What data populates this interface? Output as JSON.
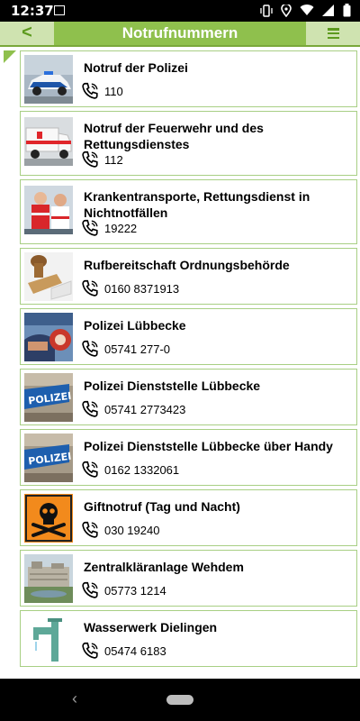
{
  "status": {
    "time": "12:37"
  },
  "appbar": {
    "back_label": "<",
    "title": "Notrufnummern"
  },
  "entries": [
    {
      "name": "Notruf der Polizei",
      "number": "110",
      "icon": "police-car-photo"
    },
    {
      "name": "Notruf der Feuerwehr und des Rettungsdienstes",
      "number": "112",
      "icon": "ambulance-photo"
    },
    {
      "name": "Krankentransporte, Rettungsdienst in Nichtnotfällen",
      "number": "19222",
      "icon": "paramedics-photo"
    },
    {
      "name": "Rufbereitschaft Ordnungsbehörde",
      "number": "0160 8371913",
      "icon": "stamp-photo"
    },
    {
      "name": "Polizei Lübbecke",
      "number": "05741 277-0",
      "icon": "police-officer-photo"
    },
    {
      "name": "Polizei Dienststelle Lübbecke",
      "number": "05741 2773423",
      "icon": "polizei-sign-photo"
    },
    {
      "name": "Polizei Dienststelle Lübbecke über Handy",
      "number": "0162 1332061",
      "icon": "polizei-sign-photo"
    },
    {
      "name": "Giftnotruf (Tag und Nacht)",
      "number": "030 19240",
      "icon": "poison-skull-icon"
    },
    {
      "name": "Zentralkläranlage Wehdem",
      "number": "05773 1214",
      "icon": "treatment-plant-photo"
    },
    {
      "name": "Wasserwerk Dielingen",
      "number": "05474 6183",
      "icon": "water-tap-photo"
    }
  ]
}
